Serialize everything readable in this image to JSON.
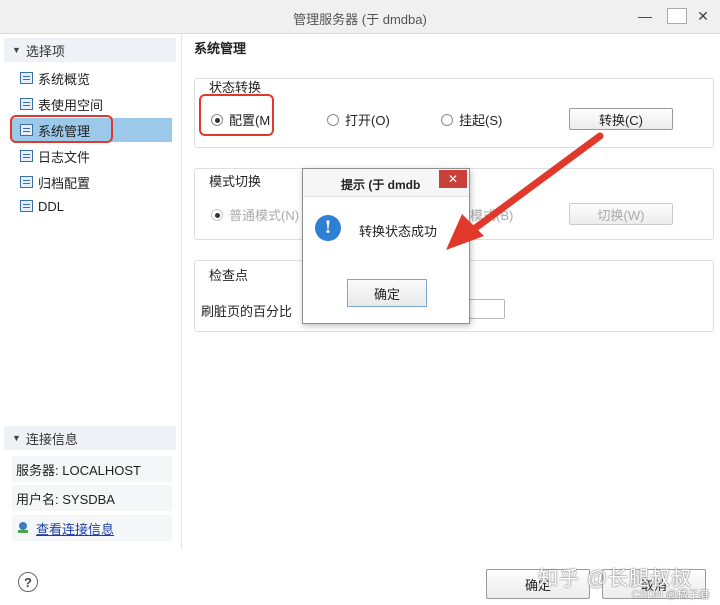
{
  "window": {
    "title": "管理服务器 (于 dmdba)",
    "min": "—",
    "max": "",
    "close": "✕"
  },
  "sidebar": {
    "options_header": "选择项",
    "items": [
      {
        "label": "系统概览"
      },
      {
        "label": "表使用空间"
      },
      {
        "label": "系统管理"
      },
      {
        "label": "日志文件"
      },
      {
        "label": "归档配置"
      },
      {
        "label": "DDL"
      }
    ],
    "conn_header": "连接信息",
    "server": "服务器: LOCALHOST",
    "user": "用户名: SYSDBA",
    "view_link": "查看连接信息"
  },
  "main": {
    "title": "系统管理",
    "state": {
      "label": "状态转换",
      "opt_config": "配置(M",
      "opt_open": "打开(O)",
      "opt_suspend": "挂起(S)",
      "convert_button": "转换(C)"
    },
    "mode": {
      "label": "模式切换",
      "opt_normal": "普通模式(N)",
      "opt_other": "机模式(B)",
      "switch_button": "切换(W)"
    },
    "checkpoint": {
      "label": "检查点",
      "dirty_label": "刷脏页的百分比"
    }
  },
  "dialog": {
    "title": "提示  (于 dmdb",
    "close": "✕",
    "icon": "!",
    "message": "转换状态成功",
    "ok": "确定"
  },
  "footer": {
    "help": "?",
    "ok": "确定",
    "cancel": "取消",
    "watermark": "知乎 @长腿叔叔",
    "csdn": "CSDN @橘子巷"
  },
  "colors": {
    "accent": "#9cc8ea",
    "highlight": "#e0392b",
    "arrow": "#e0392b",
    "info": "#2f7fd4"
  }
}
